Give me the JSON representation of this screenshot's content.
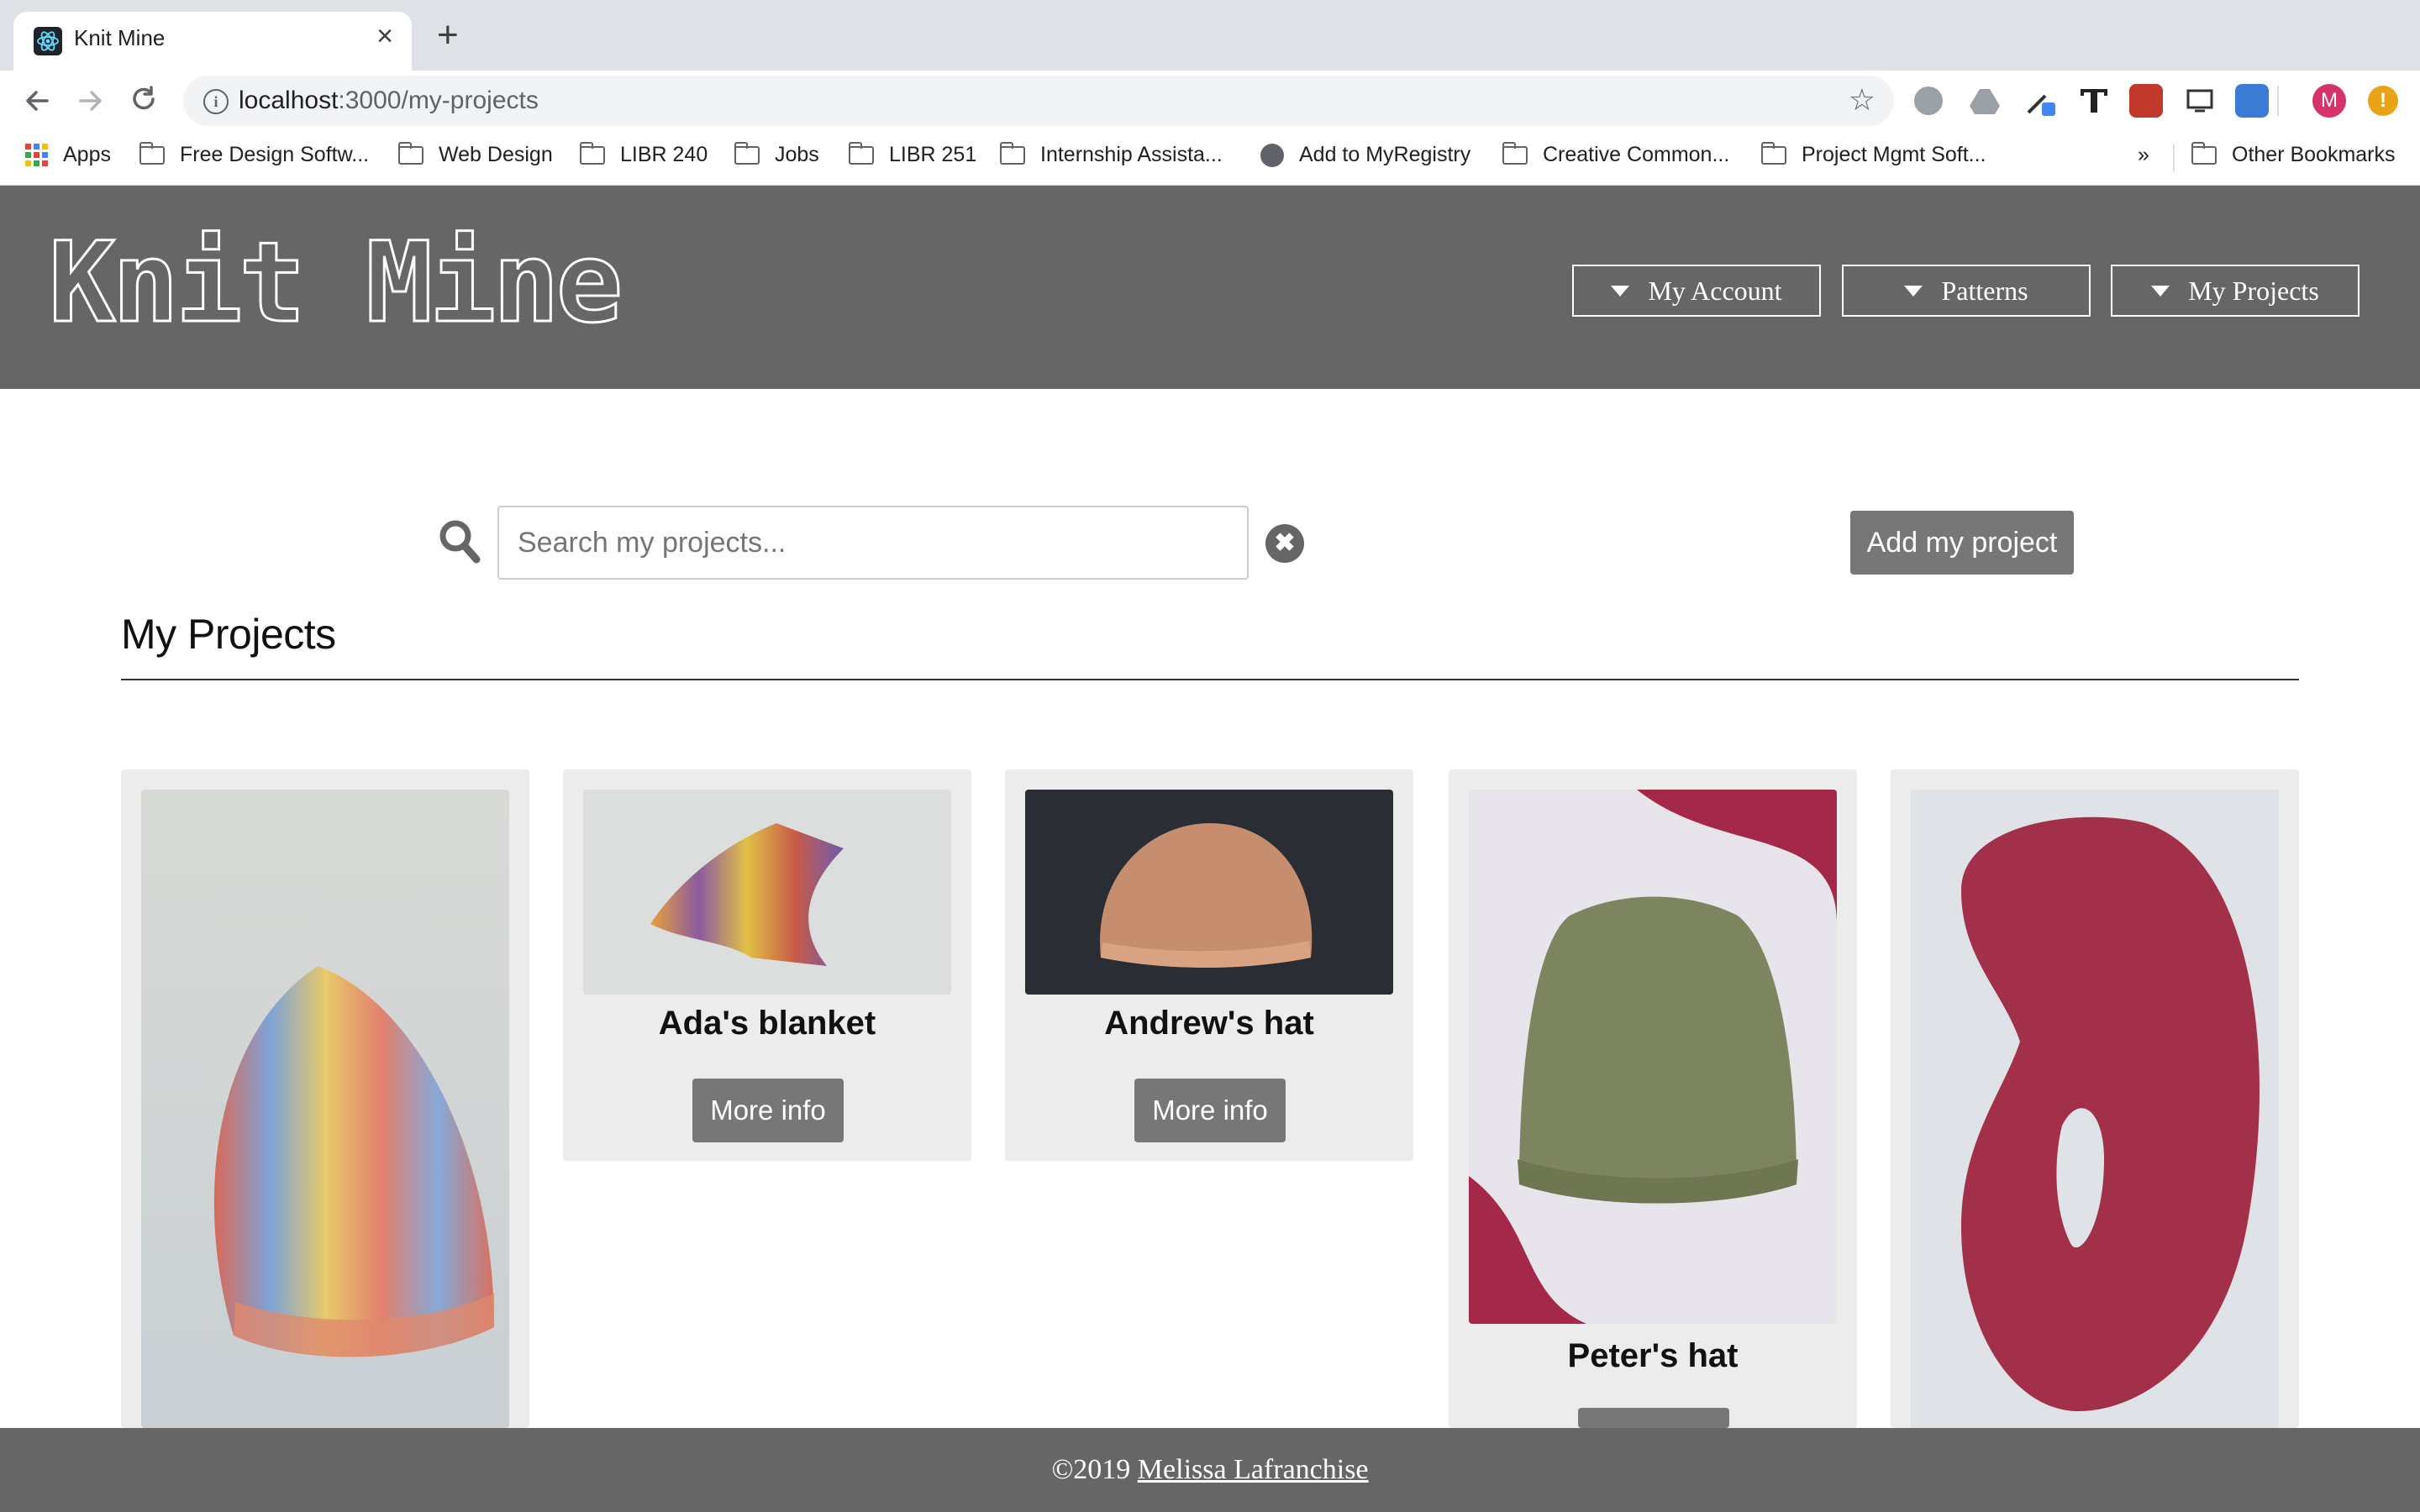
{
  "browser": {
    "tab_title": "Knit Mine",
    "tab_close": "×",
    "new_tab": "+",
    "url_host": "localhost",
    "url_path": ":3000/my-projects",
    "bookmarks": [
      {
        "label": "Apps",
        "icon": "apps-grid-icon"
      },
      {
        "label": "Free Design Softw...",
        "icon": "folder-icon"
      },
      {
        "label": "Web Design",
        "icon": "folder-icon"
      },
      {
        "label": "LIBR 240",
        "icon": "folder-icon"
      },
      {
        "label": "Jobs",
        "icon": "folder-icon"
      },
      {
        "label": "LIBR 251",
        "icon": "folder-icon"
      },
      {
        "label": "Internship Assista...",
        "icon": "folder-icon"
      },
      {
        "label": "Add to MyRegistry",
        "icon": "globe-icon"
      },
      {
        "label": "Creative Common...",
        "icon": "folder-icon"
      },
      {
        "label": "Project Mgmt Soft...",
        "icon": "folder-icon"
      }
    ],
    "overflow": "»",
    "other_bookmarks": "Other Bookmarks",
    "profile_initial": "M"
  },
  "header": {
    "logo": "Knit Mine",
    "nav": [
      {
        "label": "My Account"
      },
      {
        "label": "Patterns"
      },
      {
        "label": "My Projects"
      }
    ]
  },
  "main": {
    "search_placeholder": "Search my projects...",
    "clear_label": "✖",
    "add_button": "Add my project",
    "title": "My Projects",
    "projects": [
      {
        "name": "",
        "more": "",
        "image": "rainbow-striped-knit-hat"
      },
      {
        "name": "Ada's blanket",
        "more": "More info",
        "image": "striped-knit-blanket"
      },
      {
        "name": "Andrew's hat",
        "more": "More info",
        "image": "variegated-knit-hat"
      },
      {
        "name": "Peter's hat",
        "more": "",
        "image": "green-ribbed-knit-hat"
      },
      {
        "name": "",
        "more": "",
        "image": "red-knit-cowl"
      }
    ]
  },
  "footer": {
    "copyright": "©2019",
    "author": "Melissa Lafranchise"
  },
  "colors": {
    "header_bg": "#666666",
    "button_bg": "#777777",
    "card_bg": "#ececec"
  }
}
